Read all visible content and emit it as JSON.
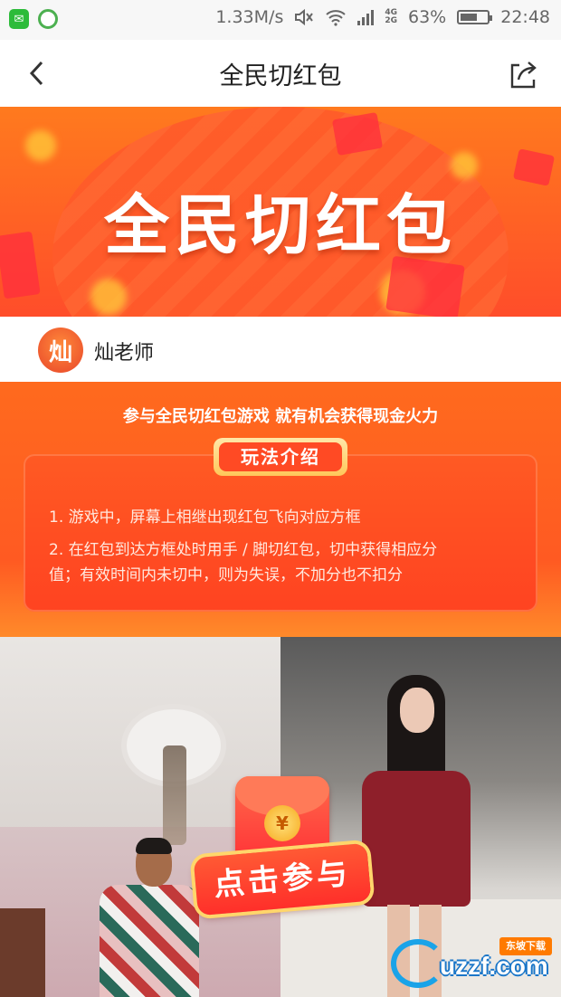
{
  "status_bar": {
    "speed": "1.33M/s",
    "network_labels": [
      "4G",
      "2G"
    ],
    "battery_percent": "63%",
    "battery_level": 0.63,
    "time": "22:48"
  },
  "nav": {
    "title": "全民切红包",
    "back_icon": "chevron-left-icon",
    "share_icon": "share-icon"
  },
  "banner": {
    "title": "全民切红包"
  },
  "user": {
    "avatar_glyph": "灿",
    "name": "灿老师"
  },
  "rules": {
    "subtitle": "参与全民切红包游戏 就有机会获得现金火力",
    "tag": "玩法介绍",
    "items": [
      "1. 游戏中，屏幕上相继出现红包飞向对应方框",
      "2. 在红包到达方框处时用手 / 脚切红包，切中获得相应分",
      "值；有效时间内未切中，则为失误，不加分也不扣分"
    ]
  },
  "join": {
    "coin_glyph": "¥",
    "label": "点击参与"
  },
  "watermark": {
    "text": "uzzf.com",
    "badge": "东坡下载"
  }
}
